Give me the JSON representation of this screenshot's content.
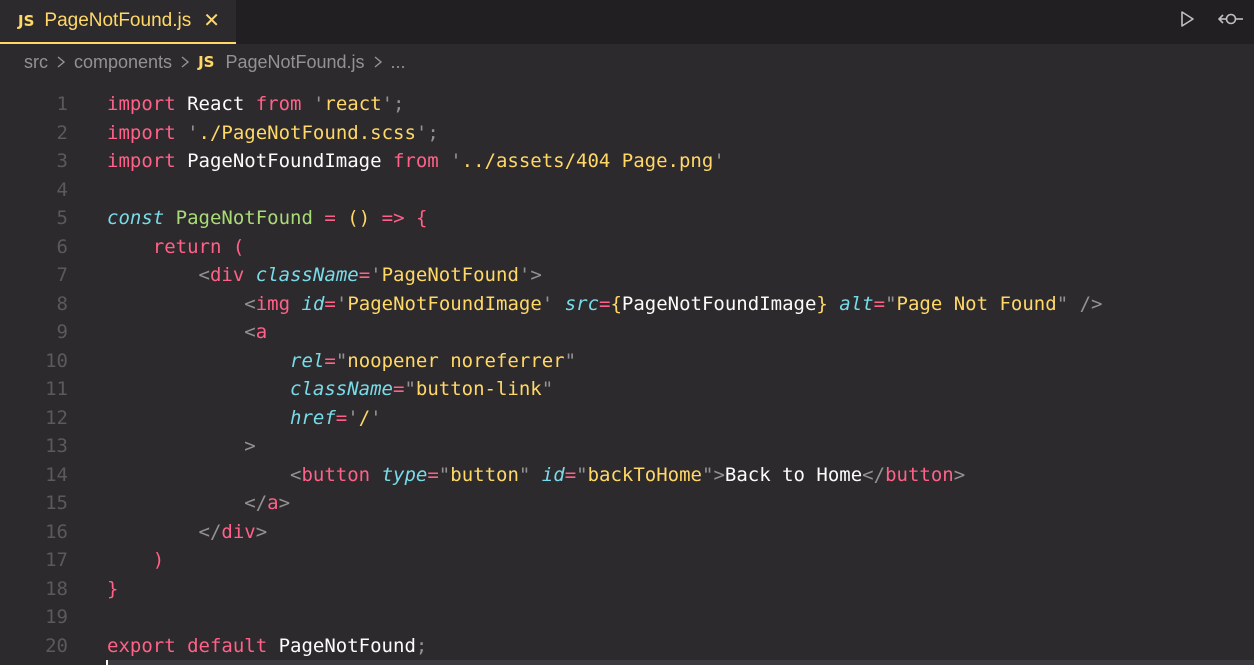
{
  "tab": {
    "badge": "JS",
    "title": "PageNotFound.js",
    "close": "✕"
  },
  "actions": {
    "run_icon": "play-icon",
    "compare_icon": "git-compare-icon"
  },
  "breadcrumb": {
    "parts": [
      "src",
      "components"
    ],
    "badge": "JS",
    "file": "PageNotFound.js",
    "more": "..."
  },
  "code": {
    "lines": [
      [
        [
          "kw",
          "import"
        ],
        [
          "def",
          " React "
        ],
        [
          "kw",
          "from"
        ],
        [
          "def",
          " "
        ],
        [
          "punc",
          "'"
        ],
        [
          "str",
          "react"
        ],
        [
          "punc",
          "'"
        ],
        [
          "punc",
          ";"
        ]
      ],
      [
        [
          "kw",
          "import"
        ],
        [
          "def",
          " "
        ],
        [
          "punc",
          "'"
        ],
        [
          "str",
          "./PageNotFound.scss"
        ],
        [
          "punc",
          "'"
        ],
        [
          "punc",
          ";"
        ]
      ],
      [
        [
          "kw",
          "import"
        ],
        [
          "def",
          " PageNotFoundImage "
        ],
        [
          "kw",
          "from"
        ],
        [
          "def",
          " "
        ],
        [
          "punc",
          "'"
        ],
        [
          "str",
          "../assets/404 Page.png"
        ],
        [
          "punc",
          "'"
        ]
      ],
      [],
      [
        [
          "attr",
          "const"
        ],
        [
          "def",
          " "
        ],
        [
          "fn",
          "PageNotFound"
        ],
        [
          "def",
          " "
        ],
        [
          "kw",
          "="
        ],
        [
          "def",
          " "
        ],
        [
          "brace-y",
          "()"
        ],
        [
          "def",
          " "
        ],
        [
          "kw",
          "=>"
        ],
        [
          "def",
          " "
        ],
        [
          "kw",
          "{"
        ]
      ],
      [
        [
          "def",
          "    "
        ],
        [
          "kw",
          "return"
        ],
        [
          "def",
          " "
        ],
        [
          "paren",
          "("
        ]
      ],
      [
        [
          "def",
          "        "
        ],
        [
          "punc",
          "<"
        ],
        [
          "kw",
          "div"
        ],
        [
          "def",
          " "
        ],
        [
          "attr",
          "className"
        ],
        [
          "kw",
          "="
        ],
        [
          "punc",
          "'"
        ],
        [
          "str",
          "PageNotFound"
        ],
        [
          "punc",
          "'"
        ],
        [
          "punc",
          ">"
        ]
      ],
      [
        [
          "def",
          "            "
        ],
        [
          "punc",
          "<"
        ],
        [
          "kw",
          "img"
        ],
        [
          "def",
          " "
        ],
        [
          "attr",
          "id"
        ],
        [
          "kw",
          "="
        ],
        [
          "punc",
          "'"
        ],
        [
          "str",
          "PageNotFoundImage"
        ],
        [
          "punc",
          "'"
        ],
        [
          "def",
          " "
        ],
        [
          "attr",
          "src"
        ],
        [
          "kw",
          "="
        ],
        [
          "brace-y",
          "{"
        ],
        [
          "def",
          "PageNotFoundImage"
        ],
        [
          "brace-y",
          "}"
        ],
        [
          "def",
          " "
        ],
        [
          "attr",
          "alt"
        ],
        [
          "kw",
          "="
        ],
        [
          "punc",
          "\""
        ],
        [
          "str",
          "Page Not Found"
        ],
        [
          "punc",
          "\""
        ],
        [
          "def",
          " "
        ],
        [
          "punc",
          "/>"
        ]
      ],
      [
        [
          "def",
          "            "
        ],
        [
          "punc",
          "<"
        ],
        [
          "kw",
          "a"
        ]
      ],
      [
        [
          "def",
          "                "
        ],
        [
          "attr",
          "rel"
        ],
        [
          "kw",
          "="
        ],
        [
          "punc",
          "\""
        ],
        [
          "str",
          "noopener noreferrer"
        ],
        [
          "punc",
          "\""
        ]
      ],
      [
        [
          "def",
          "                "
        ],
        [
          "attr",
          "className"
        ],
        [
          "kw",
          "="
        ],
        [
          "punc",
          "\""
        ],
        [
          "str",
          "button-link"
        ],
        [
          "punc",
          "\""
        ]
      ],
      [
        [
          "def",
          "                "
        ],
        [
          "attr",
          "href"
        ],
        [
          "kw",
          "="
        ],
        [
          "punc",
          "'"
        ],
        [
          "str",
          "/"
        ],
        [
          "punc",
          "'"
        ]
      ],
      [
        [
          "def",
          "            "
        ],
        [
          "punc",
          ">"
        ]
      ],
      [
        [
          "def",
          "                "
        ],
        [
          "punc",
          "<"
        ],
        [
          "kw",
          "button"
        ],
        [
          "def",
          " "
        ],
        [
          "attr",
          "type"
        ],
        [
          "kw",
          "="
        ],
        [
          "punc",
          "\""
        ],
        [
          "str",
          "button"
        ],
        [
          "punc",
          "\""
        ],
        [
          "def",
          " "
        ],
        [
          "attr",
          "id"
        ],
        [
          "kw",
          "="
        ],
        [
          "punc",
          "\""
        ],
        [
          "str",
          "backToHome"
        ],
        [
          "punc",
          "\""
        ],
        [
          "punc",
          ">"
        ],
        [
          "def",
          "Back to Home"
        ],
        [
          "punc",
          "</"
        ],
        [
          "kw",
          "button"
        ],
        [
          "punc",
          ">"
        ]
      ],
      [
        [
          "def",
          "            "
        ],
        [
          "punc",
          "</"
        ],
        [
          "kw",
          "a"
        ],
        [
          "punc",
          ">"
        ]
      ],
      [
        [
          "def",
          "        "
        ],
        [
          "punc",
          "</"
        ],
        [
          "kw",
          "div"
        ],
        [
          "punc",
          ">"
        ]
      ],
      [
        [
          "def",
          "    "
        ],
        [
          "paren",
          ")"
        ]
      ],
      [
        [
          "kw",
          "}"
        ]
      ],
      [],
      [
        [
          "kw",
          "export"
        ],
        [
          "def",
          " "
        ],
        [
          "kw",
          "default"
        ],
        [
          "def",
          " PageNotFound"
        ],
        [
          "punc",
          ";"
        ]
      ]
    ]
  }
}
